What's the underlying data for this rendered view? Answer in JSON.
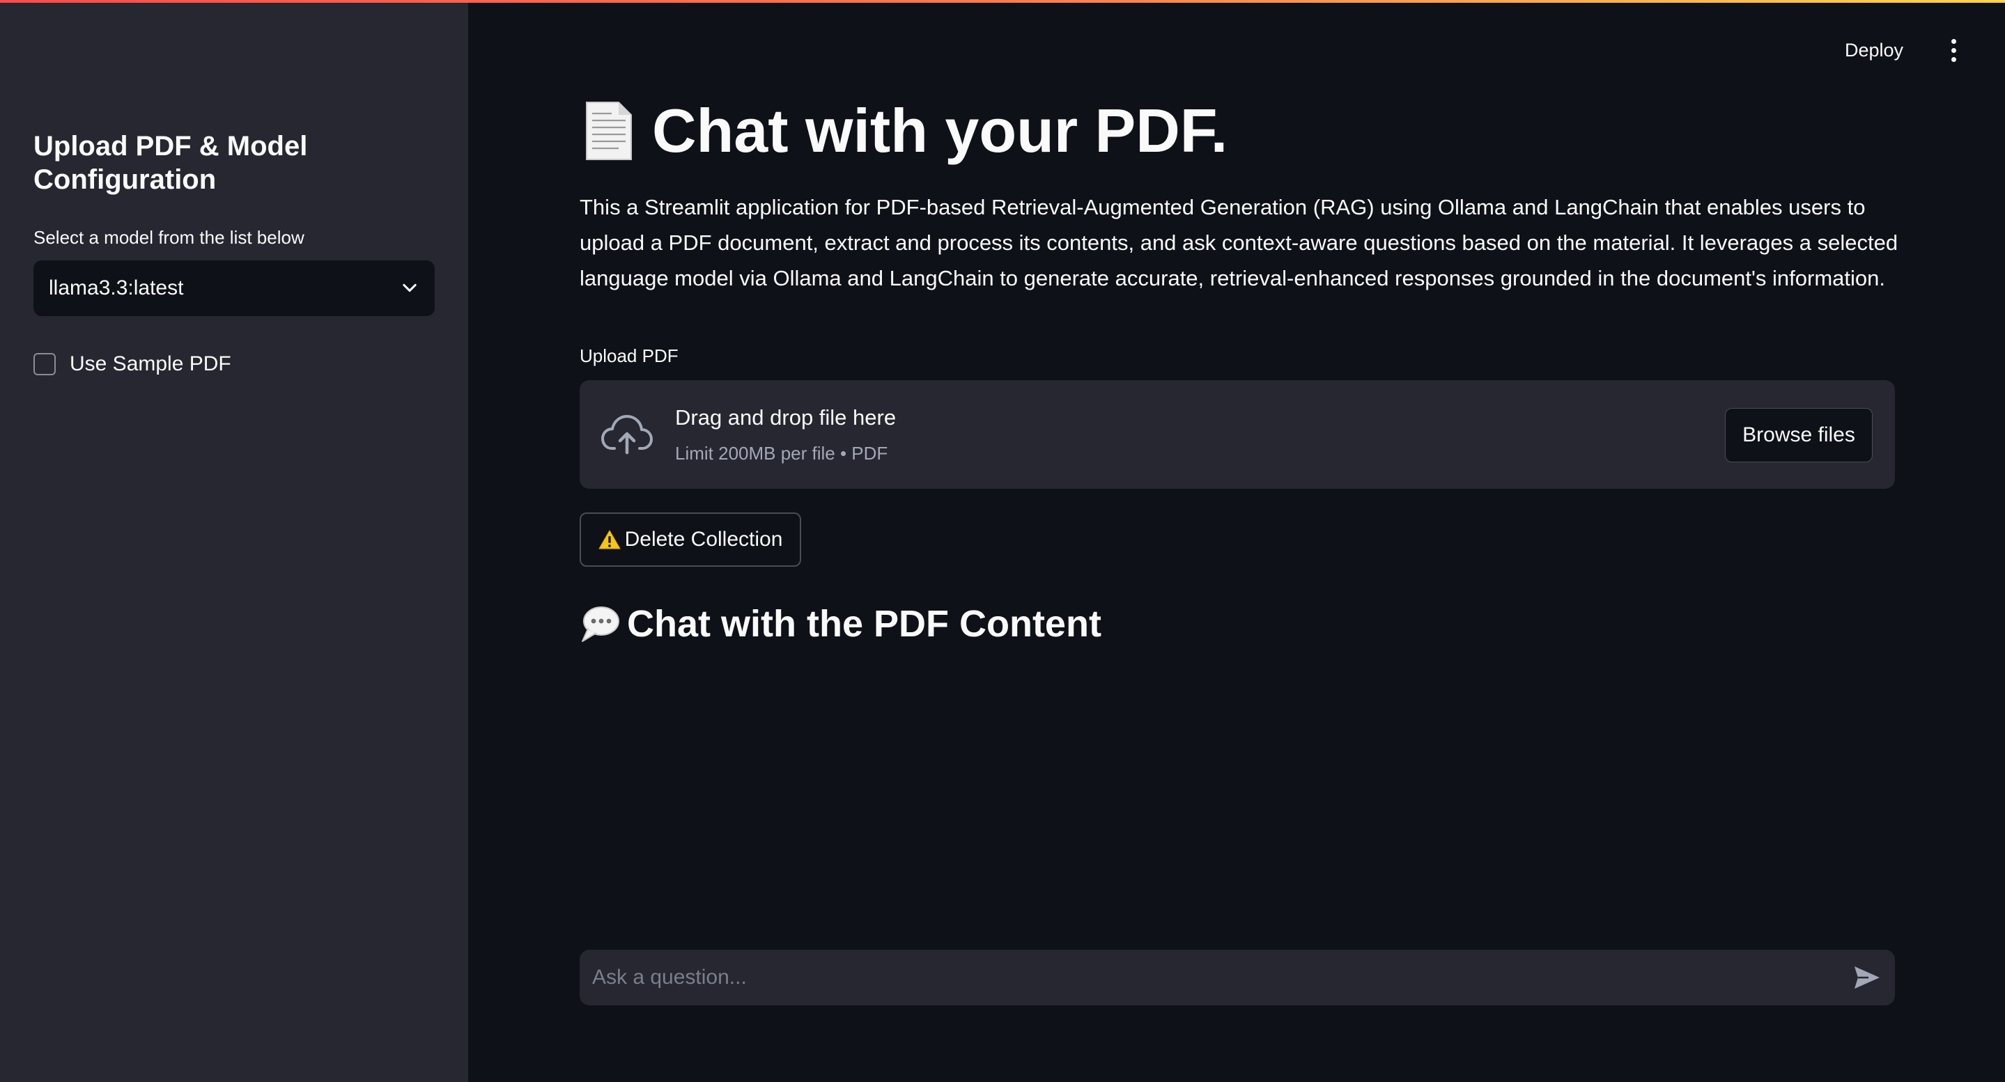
{
  "sidebar": {
    "title": "Upload PDF & Model Configuration",
    "select_label": "Select a model from the list below",
    "selected_model": "llama3.3:latest",
    "checkbox_label": "Use Sample PDF",
    "checkbox_checked": false
  },
  "header": {
    "deploy_label": "Deploy",
    "menu_icon": "kebab-menu-icon"
  },
  "main": {
    "title": "Chat with your PDF.",
    "title_icon": "page-facing-up-icon",
    "description": "This a Streamlit application for PDF-based Retrieval-Augmented Generation (RAG) using Ollama and LangChain that enables users to upload a PDF document, extract and process its contents, and ask context-aware questions based on the material. It leverages a selected language model via Ollama and LangChain to generate accurate, retrieval-enhanced responses grounded in the document's information.",
    "upload_label": "Upload PDF",
    "dropzone": {
      "main_text": "Drag and drop file here",
      "sub_text": "Limit 200MB per file • PDF",
      "browse_label": "Browse files",
      "icon": "cloud-upload-icon"
    },
    "delete_button_label": "Delete Collection",
    "delete_icon": "warning-icon",
    "chat_title": "Chat with the PDF Content",
    "chat_icon": "speech-bubble-icon"
  },
  "chat_input": {
    "placeholder": "Ask a question...",
    "value": "",
    "send_icon": "send-icon"
  },
  "colors": {
    "background": "#0e1117",
    "sidebar": "#262730",
    "text": "#fafafa",
    "muted": "#a3a8b8",
    "accent_gradient": [
      "#ff4b4b",
      "#ffd34b"
    ]
  }
}
